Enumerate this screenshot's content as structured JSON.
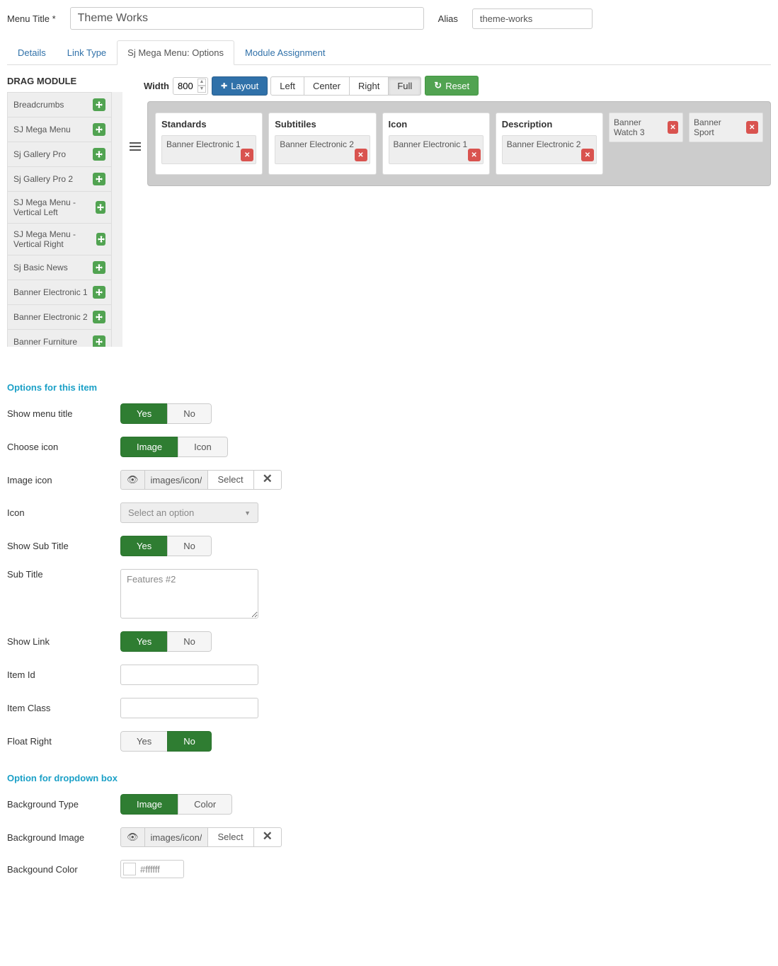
{
  "header": {
    "menu_title_label": "Menu Title *",
    "menu_title_value": "Theme Works",
    "alias_label": "Alias",
    "alias_value": "theme-works"
  },
  "tabs": [
    "Details",
    "Link Type",
    "Sj Mega Menu: Options",
    "Module Assignment"
  ],
  "tabs_active": 2,
  "drag_module": {
    "title": "DRAG MODULE",
    "items": [
      "Breadcrumbs",
      "SJ Mega Menu",
      "Sj Gallery Pro",
      "Sj Gallery Pro 2",
      "SJ Mega Menu - Vertical Left",
      "SJ Mega Menu - Vertical Right",
      "Sj Basic News",
      "Banner Electronic 1",
      "Banner Electronic 2",
      "Banner Furniture"
    ]
  },
  "toolbar": {
    "width_label": "Width",
    "width_value": "800",
    "layout_btn": "Layout",
    "align": [
      "Left",
      "Center",
      "Right",
      "Full"
    ],
    "align_active": 3,
    "reset_btn": "Reset"
  },
  "canvas": {
    "columns": [
      {
        "title": "Standards",
        "items": [
          "Banner Electronic 1"
        ]
      },
      {
        "title": "Subtitiles",
        "items": [
          "Banner Electronic 2"
        ]
      },
      {
        "title": "Icon",
        "items": [
          "Banner Electronic 1"
        ]
      },
      {
        "title": "Description",
        "items": [
          "Banner Electronic 2"
        ]
      }
    ],
    "simple": [
      {
        "label": "Banner Watch 3"
      },
      {
        "label": "Banner Sport"
      }
    ]
  },
  "options_section_title": "Options for this item",
  "options": {
    "show_menu_title": {
      "label": "Show menu title",
      "yes": "Yes",
      "no": "No",
      "value": "yes"
    },
    "choose_icon": {
      "label": "Choose icon",
      "a": "Image",
      "b": "Icon",
      "value": "a"
    },
    "image_icon": {
      "label": "Image icon",
      "path": "images/icon/flyout",
      "select": "Select"
    },
    "icon": {
      "label": "Icon",
      "placeholder": "Select an option"
    },
    "show_sub_title": {
      "label": "Show Sub Title",
      "yes": "Yes",
      "no": "No",
      "value": "yes"
    },
    "sub_title": {
      "label": "Sub Title",
      "value": "Features #2"
    },
    "show_link": {
      "label": "Show Link",
      "yes": "Yes",
      "no": "No",
      "value": "yes"
    },
    "item_id": {
      "label": "Item Id",
      "value": ""
    },
    "item_class": {
      "label": "Item Class",
      "value": ""
    },
    "float_right": {
      "label": "Float Right",
      "yes": "Yes",
      "no": "No",
      "value": "no"
    }
  },
  "dropdown_section_title": "Option for dropdown box",
  "dropdown": {
    "bg_type": {
      "label": "Background Type",
      "a": "Image",
      "b": "Color",
      "value": "a"
    },
    "bg_image": {
      "label": "Background Image",
      "path": "images/icon/flyout",
      "select": "Select"
    },
    "bg_color": {
      "label": "Backgound Color",
      "value": "#ffffff"
    }
  }
}
